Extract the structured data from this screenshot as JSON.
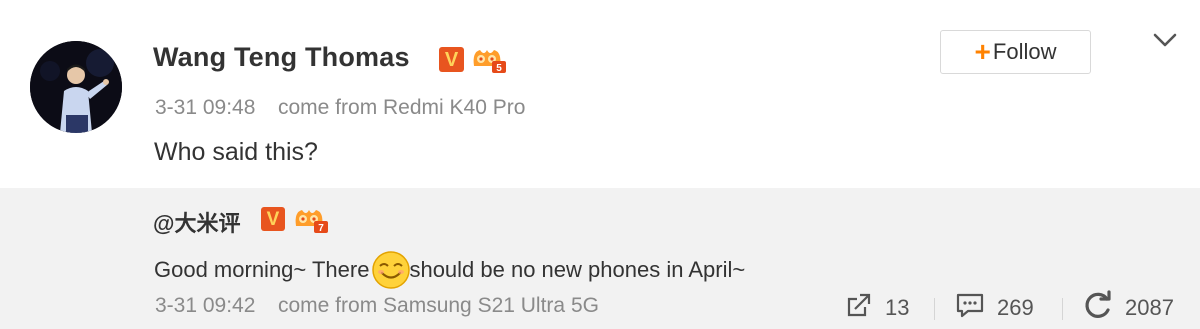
{
  "post": {
    "author": "Wang Teng Thomas",
    "verified_badge": "V",
    "level_badge": "5",
    "timestamp": "3-31 09:48",
    "source": "come from Redmi K40 Pro",
    "text": "Who said this?",
    "follow_label": "Follow",
    "follow_plus": "+"
  },
  "repost": {
    "user": "@大米评",
    "verified_badge": "V",
    "level_badge": "7",
    "text_before": "Good morning~ There",
    "text_after": "should be no new phones in April~",
    "timestamp": "3-31 09:42",
    "source": "come from Samsung S21 Ultra 5G",
    "shares": "13",
    "comments": "269",
    "likes": "2087"
  },
  "colors": {
    "accent_orange": "#ff8200",
    "badge_orange": "#e8551f",
    "badge_gold": "#ffd35a",
    "meta_gray": "#8a8a8a",
    "repost_bg": "#f2f2f2"
  },
  "icons": [
    "avatar",
    "verified-v-icon",
    "level-crown-icon",
    "chevron-down-icon",
    "smile-emoji-icon",
    "share-icon",
    "comment-icon",
    "like-refresh-icon"
  ]
}
